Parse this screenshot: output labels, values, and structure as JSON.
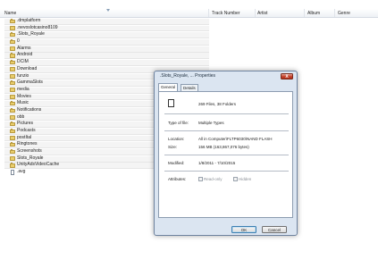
{
  "columns": {
    "name": "Name",
    "track_number": "Track Number",
    "artist": "Artist",
    "album": "Album",
    "genre": "Genre"
  },
  "items": [
    {
      "label": ".dmplatform",
      "kind": "folder"
    },
    {
      "label": ".nevoslotcasino8109",
      "kind": "folder"
    },
    {
      "label": ".Slots_Royale",
      "kind": "folder"
    },
    {
      "label": "0",
      "kind": "folder"
    },
    {
      "label": "Alarms",
      "kind": "folder"
    },
    {
      "label": "Android",
      "kind": "folder"
    },
    {
      "label": "DCIM",
      "kind": "folder"
    },
    {
      "label": "Download",
      "kind": "folder"
    },
    {
      "label": "funzio",
      "kind": "folder"
    },
    {
      "label": "GammaSlots",
      "kind": "folder"
    },
    {
      "label": "media",
      "kind": "folder"
    },
    {
      "label": "Movies",
      "kind": "folder"
    },
    {
      "label": "Music",
      "kind": "folder"
    },
    {
      "label": "Notifications",
      "kind": "folder"
    },
    {
      "label": "obb",
      "kind": "folder"
    },
    {
      "label": "Pictures",
      "kind": "folder"
    },
    {
      "label": "Podcasts",
      "kind": "folder"
    },
    {
      "label": "postItal",
      "kind": "folder"
    },
    {
      "label": "Ringtones",
      "kind": "folder"
    },
    {
      "label": "Screenshots",
      "kind": "folder"
    },
    {
      "label": "Slots_Royale",
      "kind": "folder"
    },
    {
      "label": "UnityAdsVideoCache",
      "kind": "folder"
    },
    {
      "label": ".avg",
      "kind": "file"
    }
  ],
  "dialog": {
    "title": ".Slots_Royale, ... Properties",
    "close_label": "X",
    "tabs": [
      {
        "label": "General",
        "active": true
      },
      {
        "label": "Details",
        "active": false
      }
    ],
    "summary": "269 Files, 38 Folders",
    "type_label": "Type of file:",
    "type_value": "Multiple Types",
    "location_label": "Location:",
    "location_value": "All in Computer\\FLTP6030\\NAND FLASH",
    "size_label": "Size:",
    "size_value": "156 MB (163,867,076 bytes)",
    "modified_label": "Modified:",
    "modified_value": "1/8/2011 - 7/10/2015",
    "attributes_label": "Attributes:",
    "readonly_label": "Read-only",
    "hidden_label": "Hidden",
    "ok_label": "OK",
    "cancel_label": "Cancel"
  },
  "colors": {
    "folder": "#e9cd6c",
    "dialog_bg": "#dbe5f1",
    "close_button": "#c4422a"
  }
}
